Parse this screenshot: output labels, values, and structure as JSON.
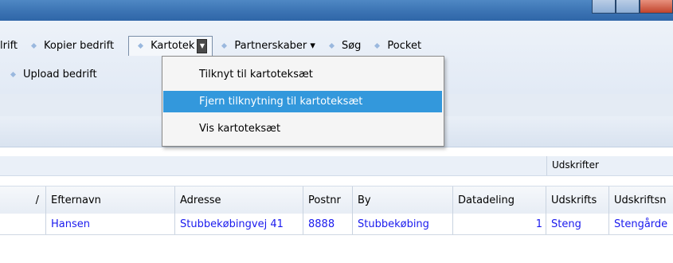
{
  "window": {
    "controls": [
      "minimize-icon",
      "maximize-icon",
      "close-icon"
    ]
  },
  "toolbar": {
    "row1": [
      {
        "label": "lrift"
      },
      {
        "label": "Kopier bedrift"
      },
      {
        "label": "Kartotek"
      },
      {
        "label": "Partnerskaber ▾"
      },
      {
        "label": "Søg"
      },
      {
        "label": "Pocket"
      }
    ],
    "row2": [
      {
        "label": "Upload bedrift"
      }
    ]
  },
  "dropdown": {
    "items": [
      {
        "label": "Tilknyt til kartoteksæt"
      },
      {
        "label": "Fjern tilknytning til kartoteksæt",
        "selected": true
      },
      {
        "label": "Vis kartoteksæt"
      }
    ]
  },
  "grid": {
    "group_caption": "Udskrifter",
    "sort_indicator": "/",
    "columns": [
      "Efternavn",
      "Adresse",
      "Postnr",
      "By",
      "Datadeling",
      "Udskrifts",
      "Udskriftsn"
    ],
    "rows": [
      [
        "Hansen",
        "Stubbekøbingvej 41",
        "8888",
        "Stubbekøbing",
        "1",
        "Steng",
        "Stengårde"
      ]
    ]
  },
  "colors": {
    "selection": "#3398dc",
    "link_text": "#1a1aee",
    "titlebar": "#3b73b3"
  }
}
